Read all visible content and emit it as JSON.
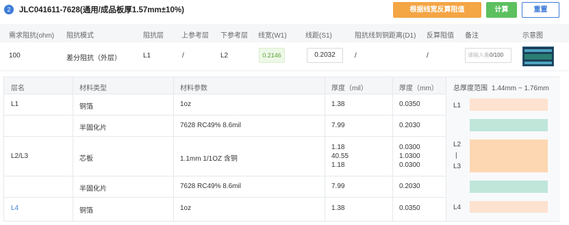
{
  "header": {
    "index": "2",
    "title": "JLC041611-7628(通用/成品板厚1.57mm±10%)",
    "buttons": {
      "reverse": "根据线宽反算阻值",
      "calc": "计算",
      "reset": "重置"
    }
  },
  "params": {
    "headers": [
      "需求阻抗(ohm)",
      "阻抗模式",
      "阻抗层",
      "上参考层",
      "下参考层",
      "线宽(W1)",
      "线距(S1)",
      "阻抗线到铜距离(D1)",
      "反算阻值",
      "备注",
      "示意图"
    ],
    "row": {
      "impedance": "100",
      "mode": "差分阻抗（外层）",
      "layer": "L1",
      "top_ref": "/",
      "bottom_ref": "L2",
      "width": "0.2146",
      "spacing": "0.2032",
      "distance": "/",
      "reverse_value": "/",
      "note_placeholder": "请输入备",
      "note_count": "0/100"
    }
  },
  "stackup": {
    "headers": [
      "层名",
      "材料类型",
      "材料参数",
      "厚度（mil）",
      "厚度（mm）"
    ],
    "rows": [
      {
        "layer": "L1",
        "type": "铜箔",
        "param": "1oz",
        "mil": "1.38",
        "mm": "0.0350"
      },
      {
        "layer": "",
        "type": "半固化片",
        "param": "7628 RC49% 8.6mil",
        "mil": "7.99",
        "mm": "0.2030"
      },
      {
        "layer": "L2/L3",
        "type": "芯板",
        "param": "1.1mm 1/1OZ 含铜",
        "mil_lines": [
          "1.18",
          "40.55",
          "1.18"
        ],
        "mm_lines": [
          "0.0300",
          "1.0300",
          "0.0300"
        ]
      },
      {
        "layer": "",
        "type": "半固化片",
        "param": "7628 RC49% 8.6mil",
        "mil": "7.99",
        "mm": "0.2030"
      },
      {
        "layer": "L4",
        "type": "铜箔",
        "param": "1oz",
        "mil": "1.38",
        "mm": "0.0350"
      }
    ],
    "range_title": "总厚度范围",
    "range_value": "1.44mm ~ 1.76mm",
    "diagram_labels": {
      "l1": "L1",
      "l2": "L2",
      "sep": "|",
      "l3": "L3",
      "l4": "L4"
    },
    "colors": {
      "copper": "#fde2d0",
      "prepreg": "#bfe6d9",
      "core": "#fdd7b1",
      "accent": "#3d7bd9"
    }
  }
}
